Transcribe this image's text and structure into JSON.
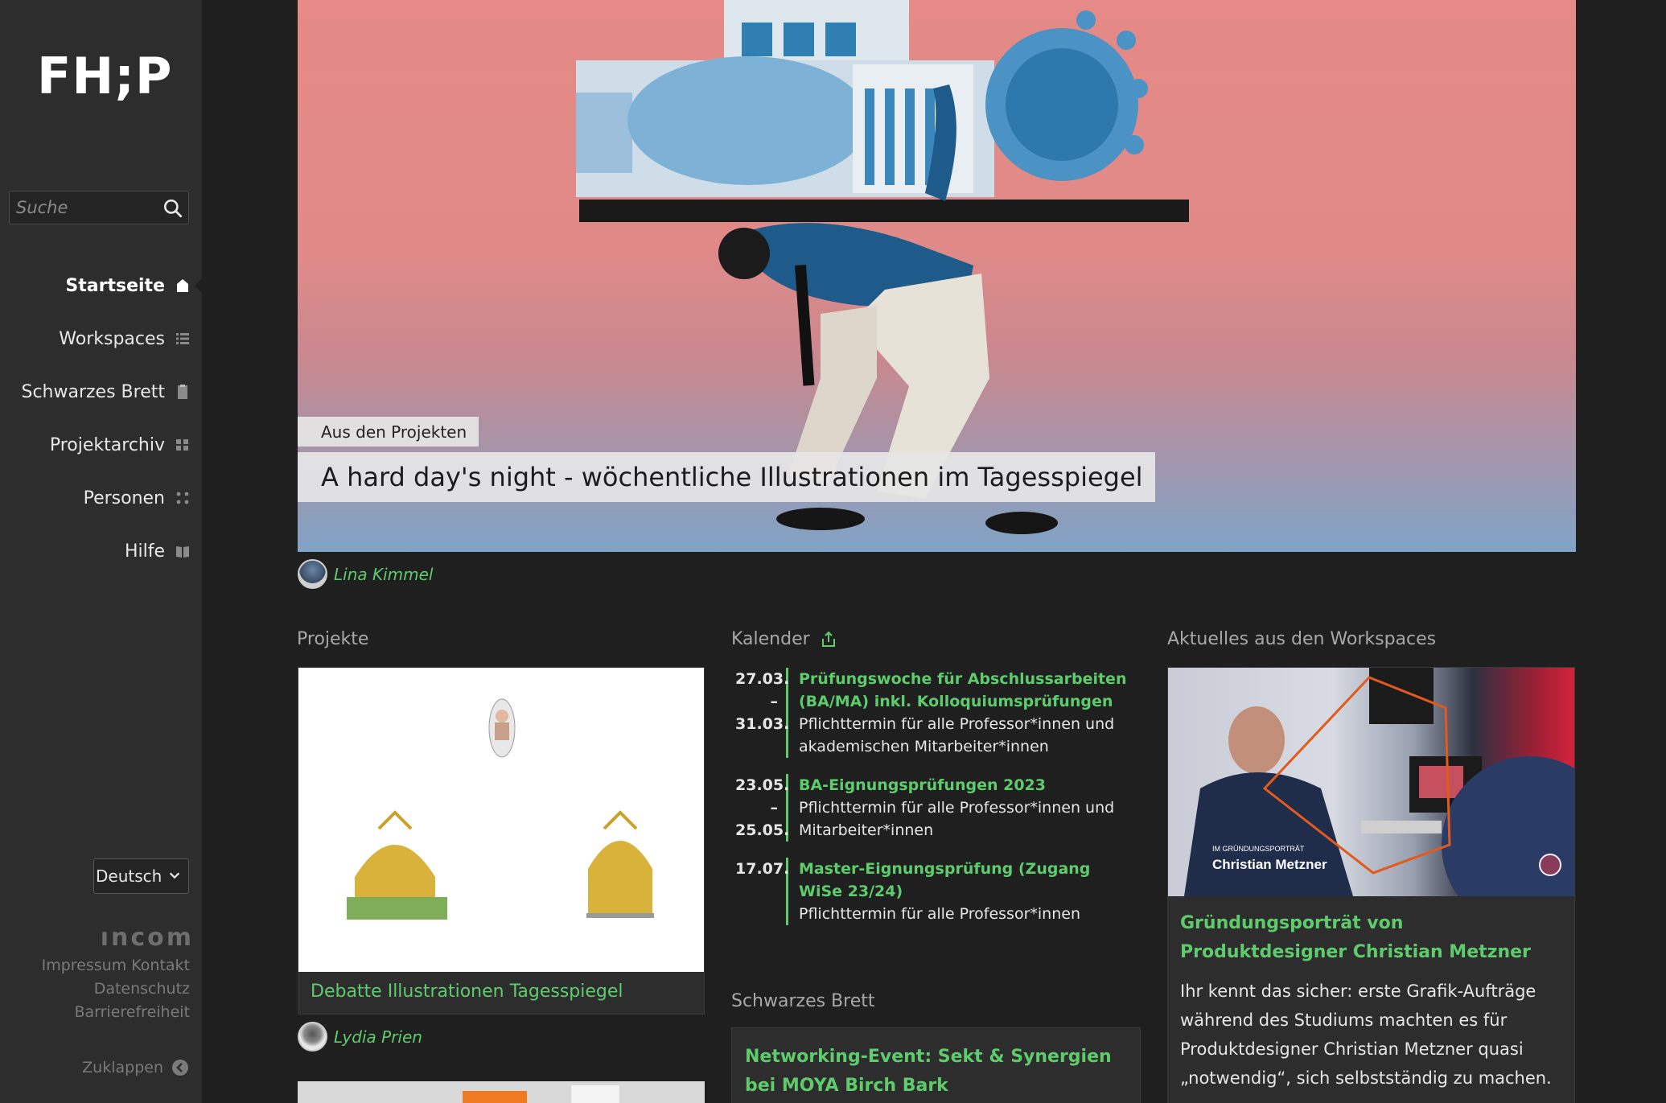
{
  "sidebar": {
    "logo": "FH;P",
    "search_placeholder": "Suche",
    "nav": [
      {
        "label": "Startseite",
        "icon": "home-icon"
      },
      {
        "label": "Workspaces",
        "icon": "list-icon"
      },
      {
        "label": "Schwarzes Brett",
        "icon": "clipboard-icon"
      },
      {
        "label": "Projektarchiv",
        "icon": "grid-icon"
      },
      {
        "label": "Personen",
        "icon": "dots-icon"
      },
      {
        "label": "Hilfe",
        "icon": "book-icon"
      }
    ],
    "language": "Deutsch",
    "brand": "ıncom",
    "footer_links": [
      "Impressum",
      "Kontakt",
      "Datenschutz",
      "Barrierefreiheit"
    ],
    "collapse_label": "Zuklappen"
  },
  "hero": {
    "tag": "Aus den Projekten",
    "title": "A hard day's night - wöchentliche Illustrationen im Tagesspiegel",
    "author": "Lina Kimmel"
  },
  "projects": {
    "heading": "Projekte",
    "card_title": "Debatte Illustrationen Tagesspiegel",
    "card_author": "Lydia Prien"
  },
  "calendar": {
    "heading": "Kalender",
    "entries": [
      {
        "date_start": "27.03.",
        "date_sep": "–",
        "date_end": "31.03.",
        "title": "Prüfungswoche für Abschlussarbeiten (BA/MA) inkl. Kolloquiumsprüfungen",
        "desc": "Pflichttermin für alle Professor*innen und akademischen Mitarbeiter*innen"
      },
      {
        "date_start": "23.05.",
        "date_sep": "–",
        "date_end": "25.05.",
        "title": "BA-Eignungsprüfungen 2023",
        "desc": "Pflichttermin für alle Professor*innen und Mitarbeiter*innen"
      },
      {
        "date_start": "17.07.",
        "date_sep": "",
        "date_end": "",
        "title": "Master-Eignungsprüfung (Zugang WiSe 23/24)",
        "desc": "Pflichttermin für alle Professor*innen"
      }
    ]
  },
  "board": {
    "heading": "Schwarzes Brett",
    "card_title": "Networking-Event: Sekt & Synergien bei MOYA Birch Bark"
  },
  "workspaces": {
    "heading": "Aktuelles aus den Workspaces",
    "image_caption_small": "IM GRÜNDUNGSPORTRÄT",
    "image_caption_name": "Christian Metzner",
    "card_title": "Gründungsporträt von Produktdesigner Christian Metzner",
    "card_text": "Ihr kennt das sicher: erste Grafik-Aufträge während des Studiums machten es für Produktdesigner Christian Metzner quasi „notwendig“, sich selbstständig zu machen."
  },
  "colors": {
    "accent": "#5ecb6d",
    "sidebar_bg": "#2d2d2d",
    "page_bg": "#1f1f1f"
  }
}
